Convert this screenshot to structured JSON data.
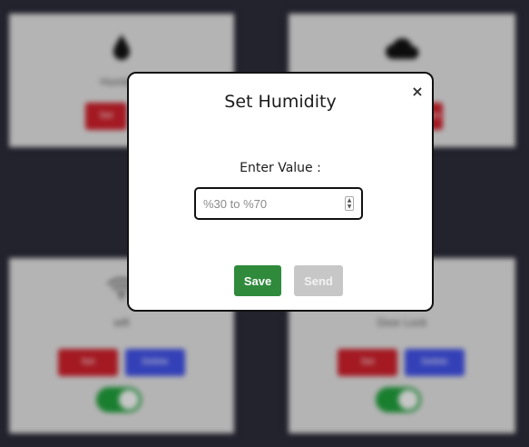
{
  "background": {
    "cards": [
      {
        "icon": "droplet-icon",
        "label": "Humidity"
      },
      {
        "icon": "cloud-icon",
        "label": ""
      },
      {
        "icon": "wifi-icon",
        "label": "wifi"
      },
      {
        "icon": "",
        "label": "Door Lock"
      }
    ],
    "button_labels": {
      "red": "Set",
      "blue": "Delete"
    }
  },
  "modal": {
    "title": "Set Humidity",
    "close_symbol": "×",
    "field_label": "Enter Value :",
    "input": {
      "placeholder": "%30 to %70",
      "value": ""
    },
    "save_label": "Save",
    "send_label": "Send"
  },
  "colors": {
    "save": "#2f8a3c",
    "send_disabled": "#c7c7c7",
    "red_button": "#c81f2a",
    "blue_button": "#3f4fe0",
    "toggle_on": "#1f9b3a"
  }
}
